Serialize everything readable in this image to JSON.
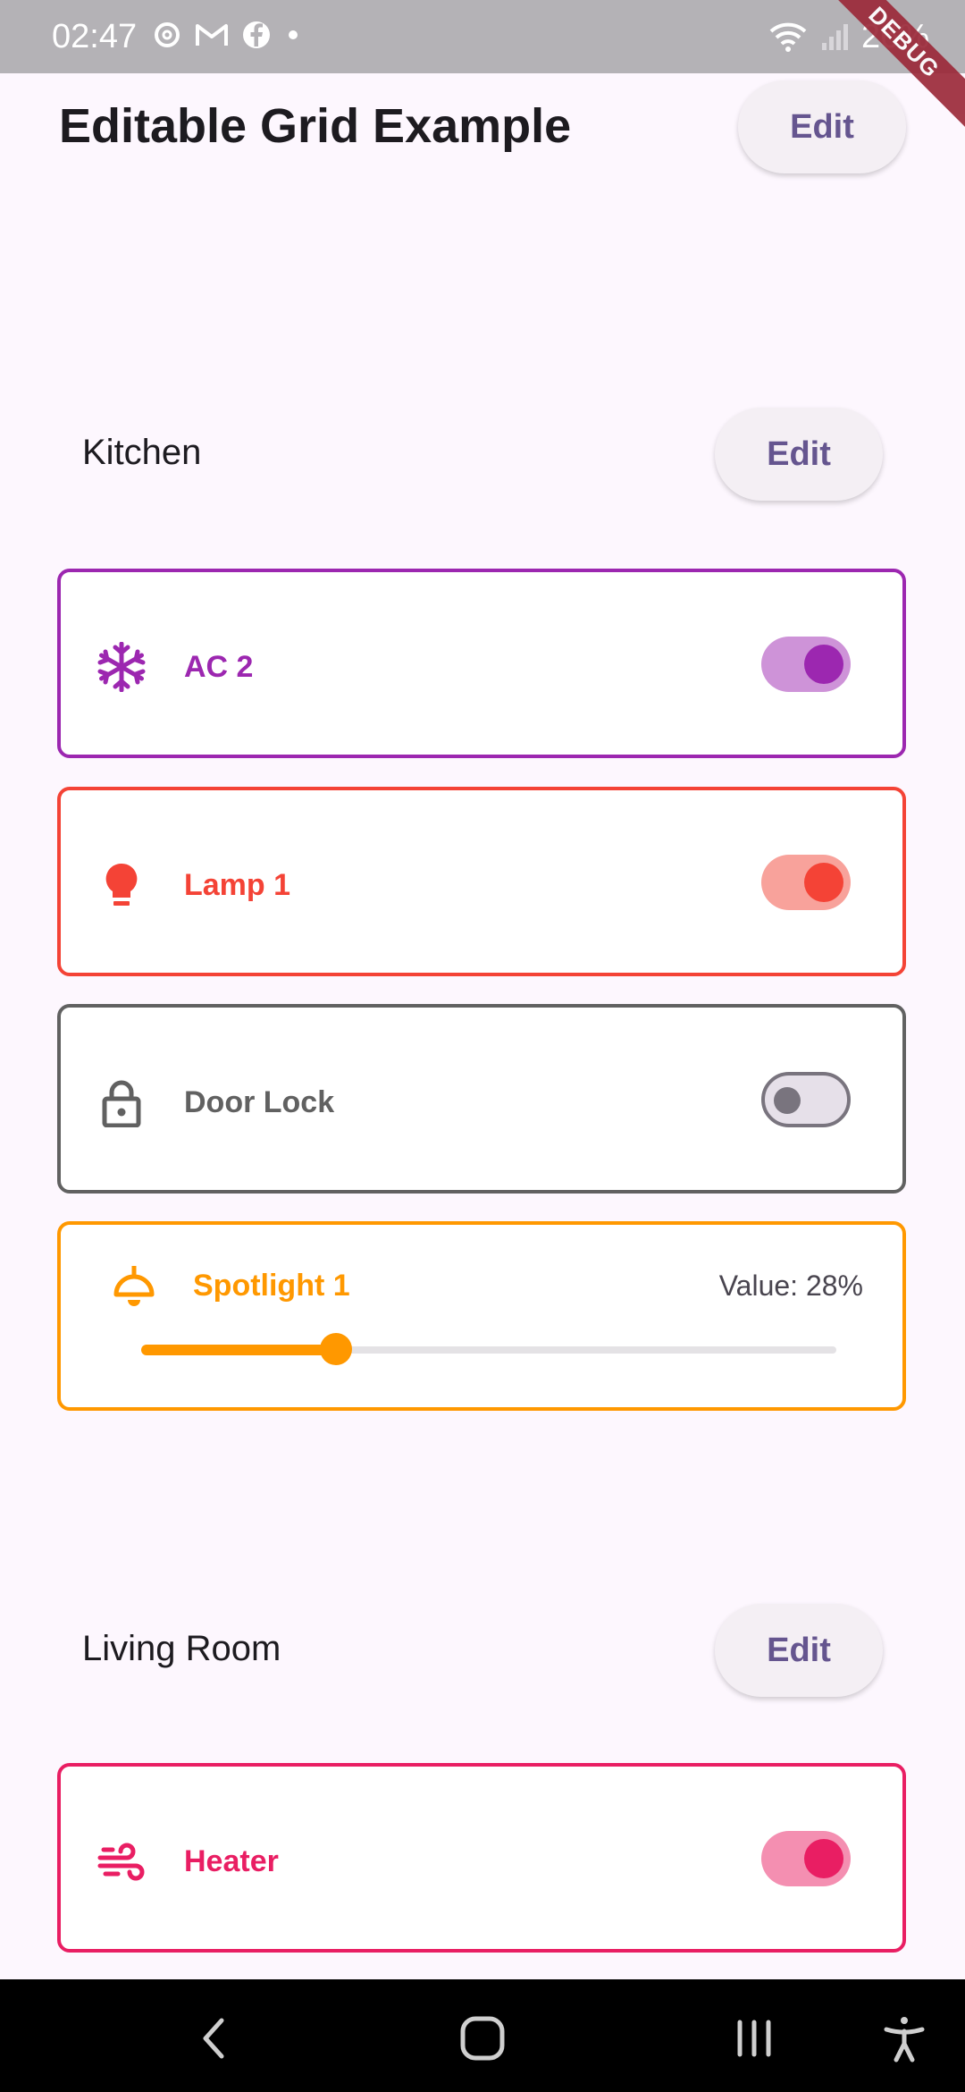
{
  "status_bar": {
    "time": "02:47",
    "battery": "26%",
    "debug_banner": "DEBUG",
    "icons": [
      "threads-icon",
      "gmail-icon",
      "facebook-icon",
      "dot-icon",
      "wifi-icon",
      "signal-icon"
    ]
  },
  "app_bar": {
    "title": "Editable Grid Example",
    "edit_label": "Edit"
  },
  "sections": [
    {
      "title": "Kitchen",
      "edit_label": "Edit",
      "devices": [
        {
          "name": "AC 2",
          "icon": "snowflake-icon",
          "color": "#9c27b0",
          "type": "switch",
          "on": true
        },
        {
          "name": "Lamp 1",
          "icon": "lightbulb-icon",
          "color": "#f44336",
          "type": "switch",
          "on": true
        },
        {
          "name": "Door Lock",
          "icon": "lock-icon",
          "color": "#616161",
          "type": "switch",
          "on": false
        },
        {
          "name": "Spotlight 1",
          "icon": "ceiling-light-icon",
          "color": "#ff9800",
          "type": "slider",
          "value_label": "Value: 28%",
          "value": 0.28
        }
      ]
    },
    {
      "title": "Living Room",
      "edit_label": "Edit",
      "devices": [
        {
          "name": "Heater",
          "icon": "wind-icon",
          "color": "#e91e63",
          "type": "switch",
          "on": true
        }
      ]
    }
  ],
  "nav_bar": {
    "buttons": [
      "back-icon",
      "home-icon",
      "recents-icon",
      "accessibility-icon"
    ]
  }
}
